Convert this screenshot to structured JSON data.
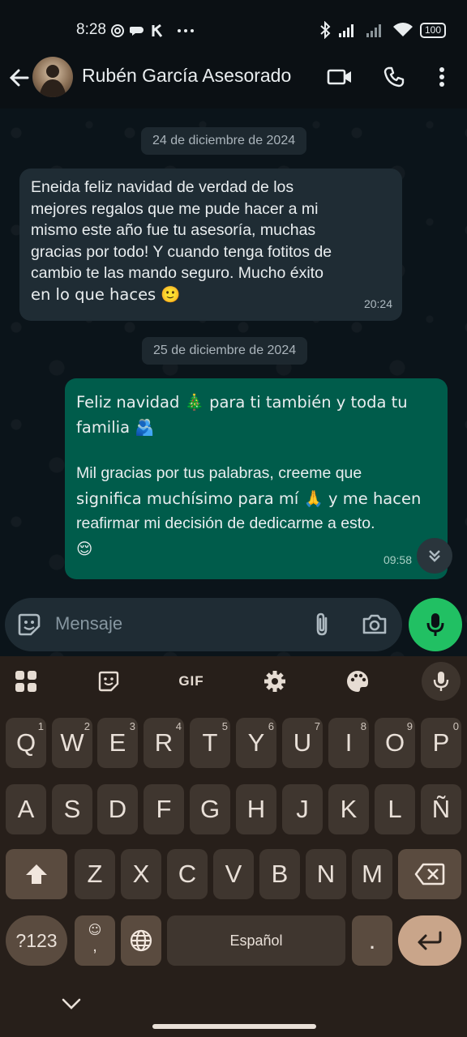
{
  "status_bar": {
    "time": "8:28",
    "battery": "100"
  },
  "header": {
    "contact_name": "Rubén García Asesorado"
  },
  "chat": {
    "date_1": "24 de diciembre de 2024",
    "msg_1": {
      "lines": [
        "Eneida feliz navidad de verdad de los",
        "mejores regalos que me pude hacer a mi",
        "mismo este año fue tu asesoría, muchas",
        "gracias por todo! Y cuando tenga fotitos de",
        "cambio te las mando seguro. Mucho éxito",
        "en lo que haces 🙂"
      ],
      "time": "20:24"
    },
    "date_2": "25 de diciembre de 2024",
    "msg_2": {
      "lines": [
        "Feliz navidad 🎄 para ti también y toda tu",
        "familia 🫂",
        "",
        "Mil gracias por tus palabras, creeme que",
        "significa muchísimo para mí 🙏 y me hacen",
        "reafirmar mi decisión de dedicarme a esto.",
        "😌"
      ],
      "time": "09:58"
    }
  },
  "input": {
    "placeholder": "Mensaje"
  },
  "keyboard": {
    "toolbar": {
      "gif_label": "GIF"
    },
    "row1": [
      {
        "k": "Q",
        "h": "1"
      },
      {
        "k": "W",
        "h": "2"
      },
      {
        "k": "E",
        "h": "3"
      },
      {
        "k": "R",
        "h": "4"
      },
      {
        "k": "T",
        "h": "5"
      },
      {
        "k": "Y",
        "h": "6"
      },
      {
        "k": "U",
        "h": "7"
      },
      {
        "k": "I",
        "h": "8"
      },
      {
        "k": "O",
        "h": "9"
      },
      {
        "k": "P",
        "h": "0"
      }
    ],
    "row2": [
      "A",
      "S",
      "D",
      "F",
      "G",
      "H",
      "J",
      "K",
      "L",
      "Ñ"
    ],
    "row3": [
      "Z",
      "X",
      "C",
      "V",
      "B",
      "N",
      "M"
    ],
    "symbols_key": "?123",
    "comma_key": ",",
    "space_label": "Español",
    "period_key": "."
  },
  "icons": {
    "accent_green": "#21c063",
    "outgoing_bubble": "#005c4b",
    "incoming_bubble": "#1f2c34"
  }
}
